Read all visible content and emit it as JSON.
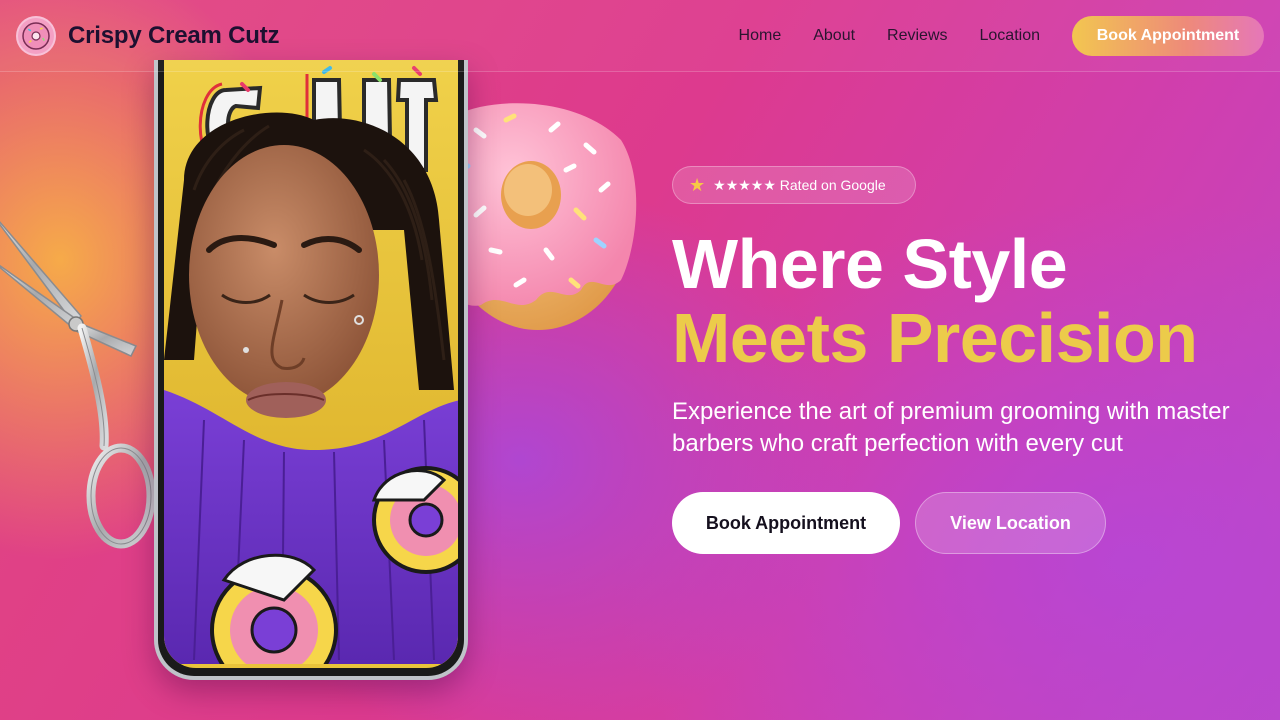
{
  "brand": {
    "name": "Crispy Cream Cutz",
    "logo_icon": "donut-icon"
  },
  "nav": {
    "links": [
      "Home",
      "About",
      "Reviews",
      "Location"
    ],
    "cta_label": "Book Appointment"
  },
  "hero": {
    "badge": {
      "icon": "star-icon",
      "text": "★★★★★ Rated on Google"
    },
    "headline_line1": "Where Style",
    "headline_line2": "Meets Precision",
    "subheadline": "Experience the art of premium grooming with master barbers who craft perfection with every cut",
    "primary_button": "Book Appointment",
    "secondary_button": "View Location"
  },
  "colors": {
    "accent_yellow": "#eccb4a",
    "background_pink": "#dd3a8e",
    "background_purple": "#bd48c6",
    "background_orange": "#f7b046"
  }
}
